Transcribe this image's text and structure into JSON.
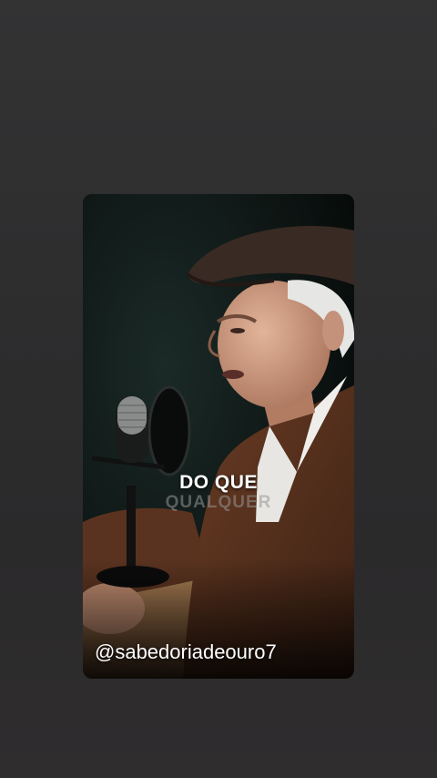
{
  "story": {
    "caption_line1": "DO QUE",
    "caption_line2": "QUALQUER",
    "handle": "@sabedoriadeouro7"
  },
  "colors": {
    "background": "#2f2f30",
    "caption_text": "#ffffff",
    "sweater": "#5a3320",
    "cap": "#3a2a24"
  },
  "icons": {
    "video_scene": "old-man-podcast-microphone"
  }
}
